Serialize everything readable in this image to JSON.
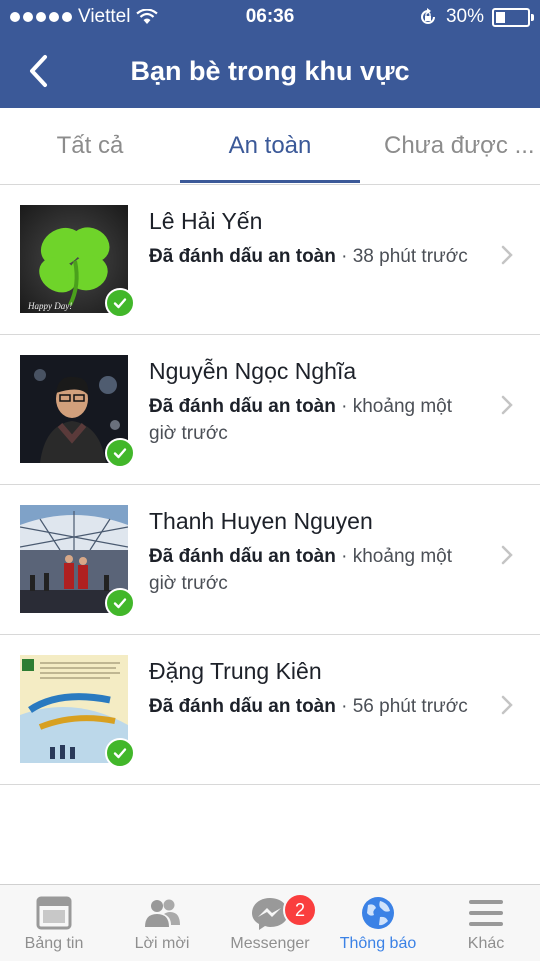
{
  "status_bar": {
    "carrier": "Viettel",
    "time": "06:36",
    "battery": "30%",
    "battery_level": 0.3
  },
  "header": {
    "title": "Bạn bè trong khu vực"
  },
  "tabs": [
    {
      "label": "Tất cả",
      "active": false
    },
    {
      "label": "An toàn",
      "active": true
    },
    {
      "label": "Chưa được ...",
      "active": false
    }
  ],
  "friends": [
    {
      "name": "Lê Hải Yến",
      "status_bold": "Đã đánh dấu an toàn",
      "status_rest": " · 38 phút trước"
    },
    {
      "name": "Nguyễn Ngọc Nghĩa",
      "status_bold": "Đã đánh dấu an toàn",
      "status_rest": " · khoảng một giờ trước"
    },
    {
      "name": "Thanh Huyen Nguyen",
      "status_bold": "Đã đánh dấu an toàn",
      "status_rest": " · khoảng một giờ trước"
    },
    {
      "name": "Đặng Trung Kiên",
      "status_bold": "Đã đánh dấu an toàn",
      "status_rest": " · 56 phút trước"
    }
  ],
  "bottom_nav": [
    {
      "label": "Bảng tin",
      "icon": "newsfeed-icon",
      "active": false
    },
    {
      "label": "Lời mời",
      "icon": "friend-requests-icon",
      "active": false
    },
    {
      "label": "Messenger",
      "icon": "messenger-icon",
      "active": false,
      "badge": "2"
    },
    {
      "label": "Thông báo",
      "icon": "globe-icon",
      "active": true
    },
    {
      "label": "Khác",
      "icon": "menu-icon",
      "active": false
    }
  ],
  "colors": {
    "brand": "#3b5998",
    "check": "#42b72a",
    "badge": "#fa3e3e",
    "active_tab_nav": "#3b82e6"
  }
}
